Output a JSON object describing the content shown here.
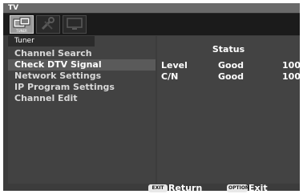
{
  "window": {
    "title": "TV"
  },
  "icon_tabs": [
    {
      "name": "tuner",
      "caption": "TUNER",
      "active": true
    },
    {
      "name": "settings",
      "caption": "",
      "active": false
    },
    {
      "name": "picture",
      "caption": "",
      "active": false
    }
  ],
  "panel": {
    "header": "Tuner",
    "menu": [
      {
        "label": "Channel Search",
        "selected": false
      },
      {
        "label": "Check DTV Signal",
        "selected": true
      },
      {
        "label": "Network Settings",
        "selected": false
      },
      {
        "label": "IP Program Settings",
        "selected": false
      },
      {
        "label": "Channel Edit",
        "selected": false
      }
    ]
  },
  "status": {
    "title": "Status",
    "rows": [
      {
        "label": "Level",
        "quality": "Good",
        "value": "100"
      },
      {
        "label": "C/N",
        "quality": "Good",
        "value": "100"
      }
    ]
  },
  "footer": {
    "return_key": "EXIT",
    "return_label": "Return",
    "exit_key": "OPTION",
    "exit_label": "Exit"
  },
  "colors": {
    "background": "#3c3c3c",
    "selected_row": "#5a5a5a",
    "text": "#ffffff"
  }
}
